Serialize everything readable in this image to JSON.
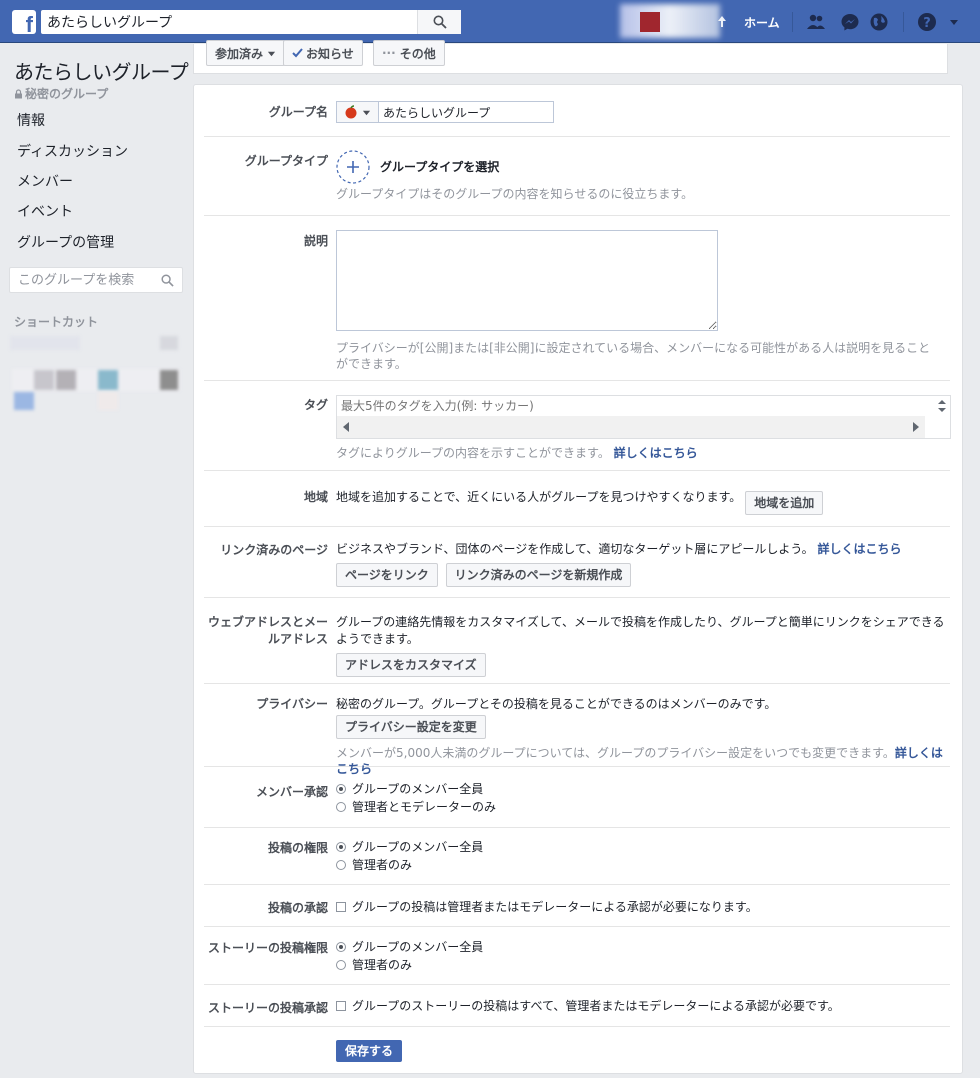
{
  "topbar": {
    "search_value": "あたらしいグループ",
    "home_label": "ホーム",
    "brand_color": "#4267b2"
  },
  "sidebar": {
    "group_name": "あたらしいグループ",
    "privacy_label": "秘密のグループ",
    "items": [
      {
        "label": "情報"
      },
      {
        "label": "ディスカッション"
      },
      {
        "label": "メンバー"
      },
      {
        "label": "イベント"
      },
      {
        "label": "グループの管理"
      }
    ],
    "search_placeholder": "このグループを検索",
    "shortcuts_heading": "ショートカット"
  },
  "header_buttons": {
    "joined": "参加済み",
    "notifications": "お知らせ",
    "more": "その他"
  },
  "settings": {
    "group_name": {
      "label": "グループ名",
      "value": "あたらしいグループ"
    },
    "group_type": {
      "label": "グループタイプ",
      "select_label": "グループタイプを選択",
      "help": "グループタイプはそのグループの内容を知らせるのに役立ちます。"
    },
    "description": {
      "label": "説明",
      "help": "プライバシーが[公開]または[非公開]に設定されている場合、メンバーになる可能性がある人は説明を見ることができます。"
    },
    "tags": {
      "label": "タグ",
      "placeholder": "最大5件のタグを入力(例: サッカー)",
      "help": "タグによりグループの内容を示すことができます。",
      "link": "詳しくはこちら"
    },
    "location": {
      "label": "地域",
      "text": "地域を追加することで、近くにいる人がグループを見つけやすくなります。",
      "button": "地域を追加"
    },
    "linked_pages": {
      "label": "リンク済みのページ",
      "text": "ビジネスやブランド、団体のページを作成して、適切なターゲット層にアピールしよう。",
      "link": "詳しくはこちら",
      "button1": "ページをリンク",
      "button2": "リンク済みのページを新規作成"
    },
    "web_address": {
      "label_line1": "ウェブアドレスとメー",
      "label_line2": "ルアドレス",
      "text": "グループの連絡先情報をカスタマイズして、メールで投稿を作成したり、グループと簡単にリンクをシェアできるようできます。",
      "button": "アドレスをカスタマイズ"
    },
    "privacy": {
      "label": "プライバシー",
      "text": "秘密のグループ。グループとその投稿を見ることができるのはメンバーのみです。",
      "button": "プライバシー設定を変更",
      "help": "メンバーが5,000人未満のグループについては、グループのプライバシー設定をいつでも変更できます。",
      "link": "詳しくはこちら"
    },
    "member_approval": {
      "label": "メンバー承認",
      "option1": "グループのメンバー全員",
      "option2": "管理者とモデレーターのみ"
    },
    "posting_permission": {
      "label": "投稿の権限",
      "option1": "グループのメンバー全員",
      "option2": "管理者のみ"
    },
    "post_approval": {
      "label": "投稿の承認",
      "text": "グループの投稿は管理者またはモデレーターによる承認が必要になります。"
    },
    "story_posting": {
      "label": "ストーリーの投稿権限",
      "option1": "グループのメンバー全員",
      "option2": "管理者のみ"
    },
    "story_approval": {
      "label": "ストーリーの投稿承認",
      "text": "グループのストーリーの投稿はすべて、管理者またはモデレーターによる承認が必要です。"
    },
    "save_button": "保存する"
  }
}
